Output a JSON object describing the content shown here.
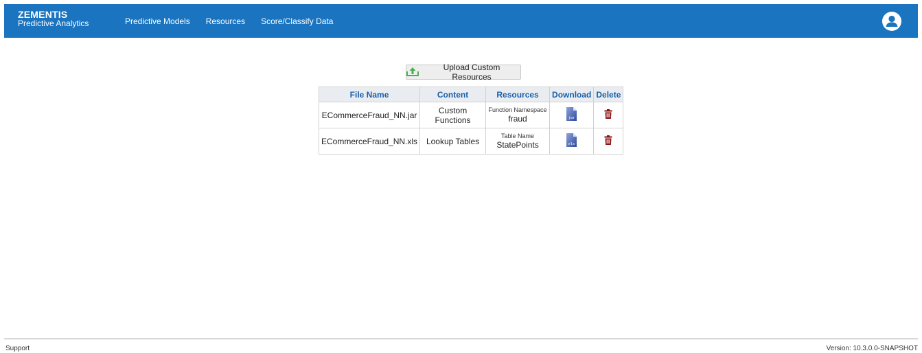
{
  "header": {
    "brand_name": "ZEMENTIS",
    "brand_subtitle": "Predictive Analytics",
    "nav": [
      "Predictive Models",
      "Resources",
      "Score/Classify Data"
    ]
  },
  "upload_button": {
    "label": "Upload Custom Resources",
    "icon": "upload-icon"
  },
  "table": {
    "headers": [
      "File Name",
      "Content",
      "Resources",
      "Download",
      "Delete"
    ],
    "rows": [
      {
        "file_name": "ECommerceFraud_NN.jar",
        "content": "Custom Functions",
        "resource_label": "Function Namespace",
        "resource_value": "fraud",
        "download_icon": "jar-file-icon",
        "file_ext": "jar",
        "delete_icon": "trash-icon"
      },
      {
        "file_name": "ECommerceFraud_NN.xls",
        "content": "Lookup Tables",
        "resource_label": "Table Name",
        "resource_value": "StatePoints",
        "download_icon": "xls-file-icon",
        "file_ext": "xls",
        "delete_icon": "trash-icon"
      }
    ]
  },
  "footer": {
    "support": "Support",
    "version": "Version: 10.3.0.0-SNAPSHOT"
  },
  "colors": {
    "header_bg": "#1a74bf",
    "header_text_link": "#1a5fa8",
    "delete": "#8b1010",
    "upload_icon": "#4caf50"
  }
}
